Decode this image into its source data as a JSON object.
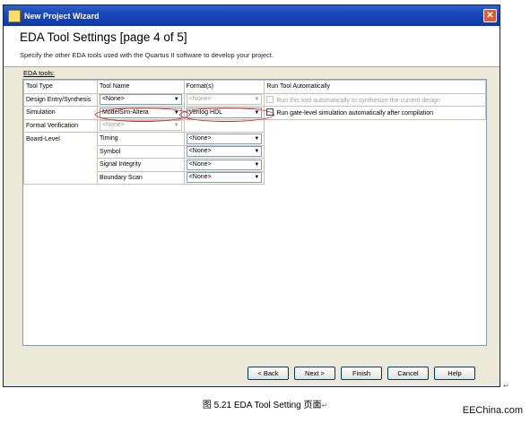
{
  "window": {
    "title": "New Project Wizard",
    "close_glyph": "✕"
  },
  "header": {
    "title": "EDA Tool Settings [page 4 of 5]",
    "subtitle": "Specify the other EDA tools used with the Quartus II software to develop your project."
  },
  "group_label": "EDA tools:",
  "table": {
    "columns": [
      "Tool Type",
      "Tool Name",
      "Format(s)",
      "Run Tool Automatically"
    ],
    "rows": [
      {
        "type": "Design Entry/Synthesis",
        "name": "<None>",
        "format": "<None>",
        "format_disabled": true,
        "run": "Run this tool automatically to synthesize the current design",
        "run_disabled": true
      },
      {
        "type": "Simulation",
        "name": "ModelSim-Altera",
        "format": "Verilog HDL",
        "format_disabled": false,
        "run": "Run gate-level simulation automatically after compilation",
        "run_disabled": false
      },
      {
        "type": "Formal Verification",
        "name": "<None>",
        "name_disabled": true
      },
      {
        "type": "Board-Level",
        "sub": "Timing",
        "format": "<None>"
      },
      {
        "type": "",
        "sub": "Symbol",
        "format": "<None>"
      },
      {
        "type": "",
        "sub": "Signal Integrity",
        "format": "<None>"
      },
      {
        "type": "",
        "sub": "Boundary Scan",
        "format": "<None>"
      }
    ]
  },
  "buttons": {
    "back": "< Back",
    "next": "Next >",
    "finish": "Finish",
    "cancel": "Cancel",
    "help": "Help"
  },
  "caption": "图 5.21 EDA Tool Setting 页面",
  "watermark": "EEChina.com",
  "icons": {
    "dropdown": "▼",
    "return": "↵"
  },
  "colors": {
    "titlebar": "#0b3aa8",
    "annotation": "#d92020",
    "dialog_bg": "#ece9d8"
  }
}
